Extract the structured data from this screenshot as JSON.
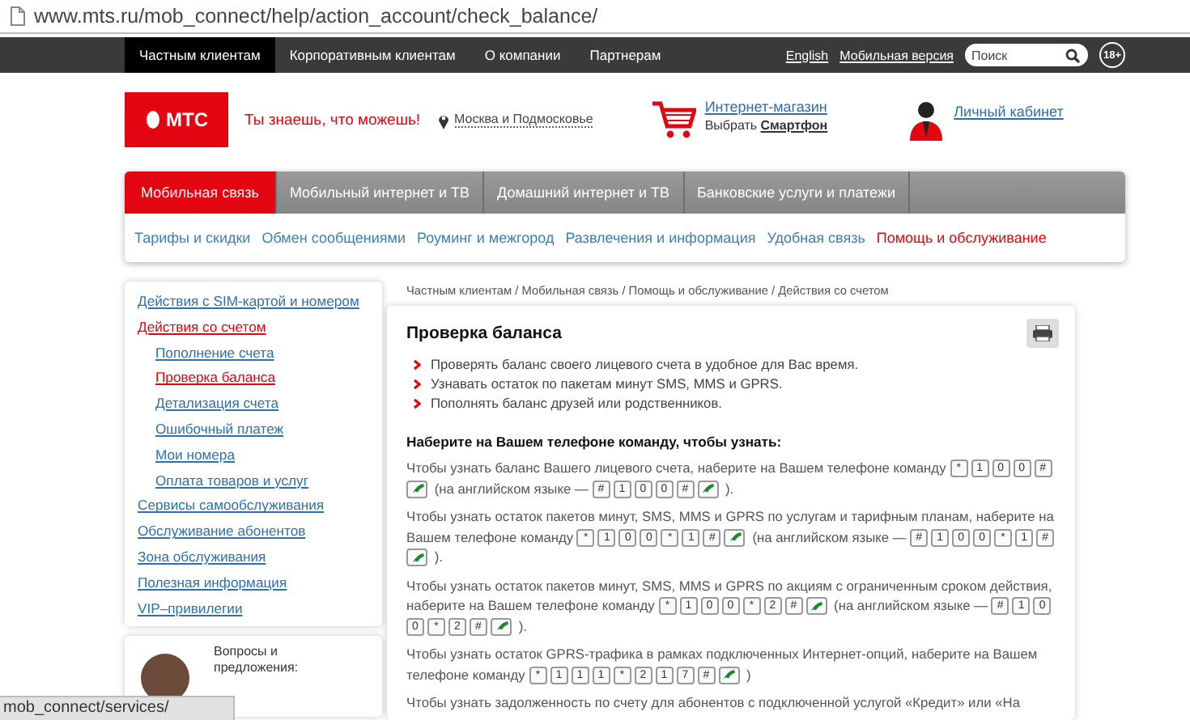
{
  "address_bar": {
    "url": "www.mts.ru/mob_connect/help/action_account/check_balance/"
  },
  "top_nav": {
    "items": [
      {
        "label": "Частным клиентам",
        "selected": true
      },
      {
        "label": "Корпоративным клиентам",
        "selected": false
      },
      {
        "label": "О компании",
        "selected": false
      },
      {
        "label": "Партнерам",
        "selected": false
      }
    ],
    "links": [
      "English",
      "Мобильная версия"
    ],
    "search": {
      "placeholder": "Поиск"
    },
    "age_badge": "18+"
  },
  "header": {
    "logo": "МТС",
    "slogan": "Ты знаешь, что можешь!",
    "region": "Москва и Подмосковье",
    "shop_link": "Интернет-магазин",
    "shop_note": "Выбрать **Смартфон**",
    "account_link": "Личный кабинет"
  },
  "tabs": [
    {
      "label": "Мобильная связь",
      "selected": true
    },
    {
      "label": "Мобильный интернет и ТВ",
      "selected": false
    },
    {
      "label": "Домашний интернет и ТВ",
      "selected": false
    },
    {
      "label": "Банковские услуги и платежи",
      "selected": false
    }
  ],
  "submenu": [
    {
      "label": "Тарифы и скидки",
      "selected": false
    },
    {
      "label": "Обмен сообщениями",
      "selected": false
    },
    {
      "label": "Роуминг и межгород",
      "selected": false
    },
    {
      "label": "Развлечения и информация",
      "selected": false
    },
    {
      "label": "Удобная связь",
      "selected": false
    },
    {
      "label": "Помощь и обслуживание",
      "selected": true
    }
  ],
  "sidebar": {
    "items": [
      {
        "label": "Действия с SIM-картой и номером",
        "selected": false
      },
      {
        "label": "Действия со счетом",
        "selected": true,
        "children": [
          {
            "label": "Пополнение счета",
            "selected": false
          },
          {
            "label": "Проверка баланса",
            "selected": true
          },
          {
            "label": "Детализация счета",
            "selected": false
          },
          {
            "label": "Ошибочный платеж",
            "selected": false
          },
          {
            "label": "Мои номера",
            "selected": false
          },
          {
            "label": "Оплата товаров и услуг",
            "selected": false
          }
        ]
      },
      {
        "label": "Сервисы самообслуживания",
        "selected": false
      },
      {
        "label": "Обслуживание абонентов",
        "selected": false
      },
      {
        "label": "Зона обслуживания",
        "selected": false
      },
      {
        "label": "Полезная информация",
        "selected": false
      },
      {
        "label": "VIP–привилегии",
        "selected": false
      }
    ],
    "feedback": {
      "text": "Вопросы и предложения:"
    }
  },
  "breadcrumb": "Частным клиентам / Мобильная связь / Помощь и обслуживание / Действия со счетом",
  "article": {
    "title": "Проверка баланса",
    "bullets": [
      "Проверять баланс своего лицевого счета в удобное для Вас время.",
      "Узнавать остаток по пакетам минут SMS, MMS и GPRS.",
      "Пополнять баланс друзей или родственников."
    ],
    "heading": "Наберите на Вашем телефоне команду, чтобы узнать:",
    "paragraphs": [
      [
        {
          "kind": "text",
          "text": "Чтобы узнать баланс Вашего лицевого счета, наберите на Вашем телефоне команду"
        },
        {
          "kind": "keys",
          "keys": [
            "*",
            "1",
            "0",
            "0",
            "#"
          ]
        },
        {
          "kind": "call"
        },
        {
          "kind": "text",
          "text": "(на английском языке —"
        },
        {
          "kind": "keys",
          "keys": [
            "#",
            "1",
            "0",
            "0",
            "#"
          ]
        },
        {
          "kind": "call"
        },
        {
          "kind": "text",
          "text": ")."
        }
      ],
      [
        {
          "kind": "text",
          "text": "Чтобы узнать остаток пакетов минут, SMS, MMS и GPRS по услугам и тарифным планам, наберите на Вашем телефоне команду"
        },
        {
          "kind": "keys",
          "keys": [
            "*",
            "1",
            "0",
            "0",
            "*",
            "1",
            "#"
          ]
        },
        {
          "kind": "call"
        },
        {
          "kind": "text",
          "text": "(на английском языке —"
        },
        {
          "kind": "keys",
          "keys": [
            "#",
            "1",
            "0",
            "0",
            "*",
            "1",
            "#"
          ]
        },
        {
          "kind": "call"
        },
        {
          "kind": "text",
          "text": ")."
        }
      ],
      [
        {
          "kind": "text",
          "text": "Чтобы узнать остаток пакетов минут, SMS, MMS и GPRS по акциям с ограниченным сроком действия, наберите на Вашем телефоне команду"
        },
        {
          "kind": "keys",
          "keys": [
            "*",
            "1",
            "0",
            "0",
            "*",
            "2",
            "#"
          ]
        },
        {
          "kind": "call"
        },
        {
          "kind": "text",
          "text": "(на английском языке —"
        },
        {
          "kind": "keys",
          "keys": [
            "#",
            "1",
            "0",
            "0",
            "*",
            "2",
            "#"
          ]
        },
        {
          "kind": "call"
        },
        {
          "kind": "text",
          "text": ")."
        }
      ],
      [
        {
          "kind": "text",
          "text": "Чтобы узнать остаток GPRS-трафика в рамках подключенных Интернет-опций, наберите на Вашем телефоне команду"
        },
        {
          "kind": "keys",
          "keys": [
            "*",
            "1",
            "1",
            "1",
            "*",
            "2",
            "1",
            "7",
            "#"
          ]
        },
        {
          "kind": "call"
        },
        {
          "kind": "text",
          "text": ")"
        }
      ],
      [
        {
          "kind": "text",
          "text": "Чтобы узнать задолженность по счету для абонентов с подключенной услугой «Кредит» или «На"
        }
      ]
    ]
  },
  "status_bar": {
    "url": "mob_connect/services/"
  }
}
